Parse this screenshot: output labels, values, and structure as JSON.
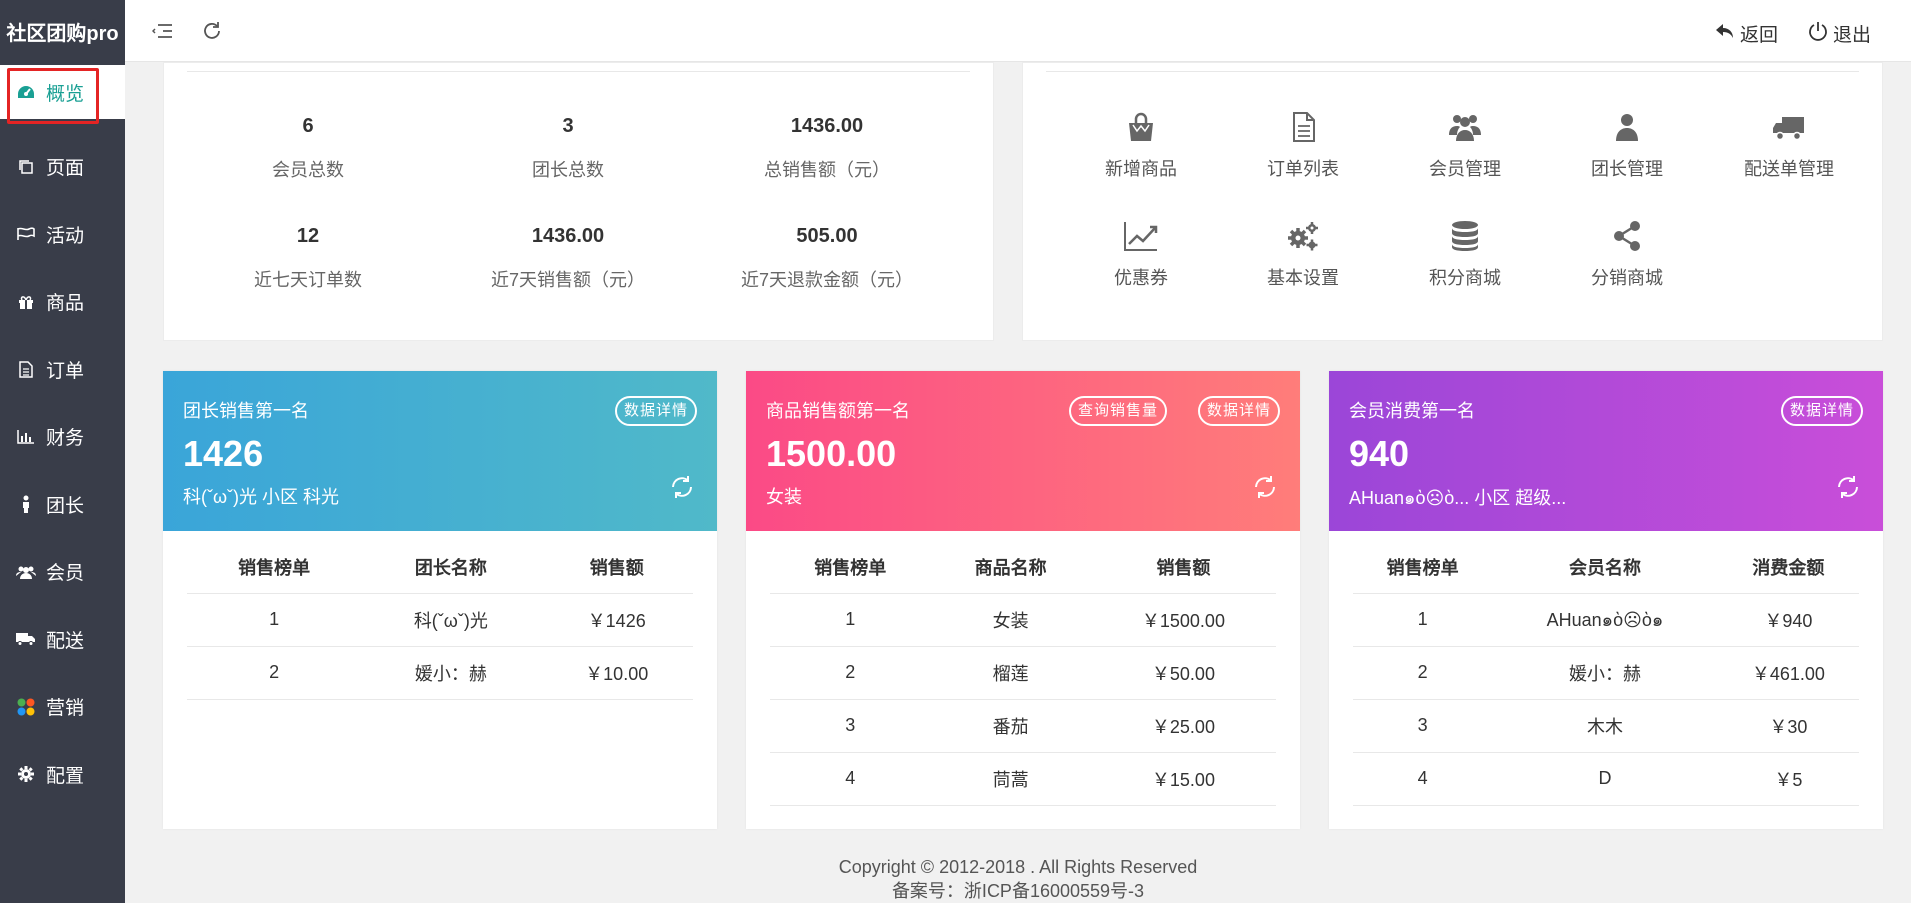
{
  "app": {
    "brand": "社区团购pro"
  },
  "sidebar": {
    "items": [
      {
        "label": "概览",
        "icon": "dashboard-icon"
      },
      {
        "label": "页面",
        "icon": "copy-icon"
      },
      {
        "label": "活动",
        "icon": "flag-icon"
      },
      {
        "label": "商品",
        "icon": "gift-icon"
      },
      {
        "label": "订单",
        "icon": "file-icon"
      },
      {
        "label": "财务",
        "icon": "bar-chart-icon"
      },
      {
        "label": "团长",
        "icon": "person-icon"
      },
      {
        "label": "会员",
        "icon": "users-icon"
      },
      {
        "label": "配送",
        "icon": "truck-icon"
      },
      {
        "label": "营销",
        "icon": "apps-icon"
      },
      {
        "label": "配置",
        "icon": "gear-icon"
      }
    ]
  },
  "header": {
    "back_label": "返回",
    "logout_label": "退出"
  },
  "stats": [
    {
      "value": "6",
      "label": "会员总数"
    },
    {
      "value": "3",
      "label": "团长总数"
    },
    {
      "value": "1436.00",
      "label": "总销售额（元）"
    },
    {
      "value": "12",
      "label": "近七天订单数"
    },
    {
      "value": "1436.00",
      "label": "近7天销售额（元）"
    },
    {
      "value": "505.00",
      "label": "近7天退款金额（元）"
    }
  ],
  "quick_links": [
    {
      "label": "新增商品",
      "icon": "shopping-bag-icon"
    },
    {
      "label": "订单列表",
      "icon": "document-icon"
    },
    {
      "label": "会员管理",
      "icon": "users-icon"
    },
    {
      "label": "团长管理",
      "icon": "user-icon"
    },
    {
      "label": "配送单管理",
      "icon": "truck-icon"
    },
    {
      "label": "优惠券",
      "icon": "line-chart-icon"
    },
    {
      "label": "基本设置",
      "icon": "gears-icon"
    },
    {
      "label": "积分商城",
      "icon": "database-icon"
    },
    {
      "label": "分销商城",
      "icon": "share-icon"
    }
  ],
  "cards": [
    {
      "title": "团长销售第一名",
      "value": "1426",
      "subtitle": "科(ˇωˇ)光 小区 科光",
      "buttons": [
        "数据详情"
      ],
      "gradient": [
        "#3aa5d9",
        "#50b9c9"
      ],
      "headers": [
        "销售榜单",
        "团长名称",
        "销售额"
      ],
      "rows": [
        [
          "1",
          "科(ˇωˇ)光",
          "￥1426"
        ],
        [
          "2",
          "媛小：赫",
          "￥10.00"
        ]
      ]
    },
    {
      "title": "商品销售额第一名",
      "value": "1500.00",
      "subtitle": "女装",
      "buttons": [
        "查询销售量",
        "数据详情"
      ],
      "gradient": [
        "#fb4a86",
        "#ff7d7a"
      ],
      "headers": [
        "销售榜单",
        "商品名称",
        "销售额"
      ],
      "rows": [
        [
          "1",
          "女装",
          "￥1500.00"
        ],
        [
          "2",
          "榴莲",
          "￥50.00"
        ],
        [
          "3",
          "番茄",
          "￥25.00"
        ],
        [
          "4",
          "茼蒿",
          "￥15.00"
        ]
      ]
    },
    {
      "title": "会员消费第一名",
      "value": "940",
      "subtitle": "AHuan๑ὸ☹ὸ... 小区 超级...",
      "buttons": [
        "数据详情"
      ],
      "gradient": [
        "#9b46d8",
        "#c94ed9"
      ],
      "headers": [
        "销售榜单",
        "会员名称",
        "消费金额"
      ],
      "rows": [
        [
          "1",
          "AHuan๑ὸ☹ὸ๑",
          "￥940"
        ],
        [
          "2",
          "媛小：赫",
          "￥461.00"
        ],
        [
          "3",
          "木木",
          "￥30"
        ],
        [
          "4",
          "D",
          "￥5"
        ]
      ]
    }
  ],
  "footer": {
    "copyright": "Copyright © 2012-2018 . All Rights Reserved",
    "icp": "备案号：浙ICP备16000559号-3"
  }
}
